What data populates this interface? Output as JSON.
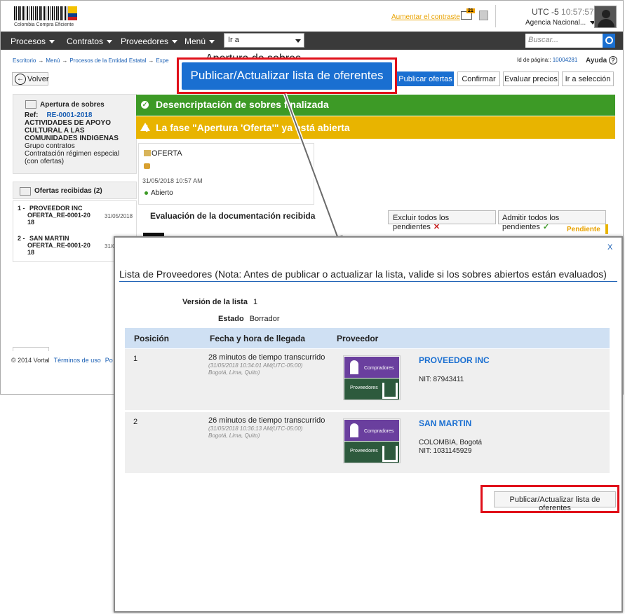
{
  "header": {
    "logo_text": "Colombia Compra Eficiente",
    "contrast_link": "Aumentar el contraste",
    "mail_count": "21",
    "utc_label": "UTC -5",
    "utc_time": "10:57:57",
    "agency": "Agencia Nacional..."
  },
  "nav": {
    "items": [
      "Procesos",
      "Contratos",
      "Proveedores",
      "Menú"
    ],
    "goto_value": "Ir a",
    "search_placeholder": "Buscar..."
  },
  "breadcrumb": {
    "items": [
      "Escritorio",
      "Menú",
      "Procesos de la Entidad Estatal",
      "Expe"
    ],
    "heading_fragment": "Apertura de sobres"
  },
  "page_info": {
    "id_label": "Id de página::",
    "id_value": "10004281",
    "help": "Ayuda"
  },
  "toolbar": {
    "back": "Volver",
    "callout_button": "Publicar/Actualizar lista de oferentes",
    "tabs": [
      "Publicar ofertas",
      "Confirmar",
      "Evaluar precios",
      "Ir a selección"
    ]
  },
  "process_panel": {
    "title": "Apertura de sobres",
    "ref_label": "Ref:",
    "ref_value": "RE-0001-2018",
    "object": "ACTIVIDADES DE APOYO CULTURAL A LAS COMUNIDADES INDIGENAS",
    "group": "Grupo contratos",
    "type": "Contratación régimen especial (con ofertas)"
  },
  "offers": {
    "header": "Ofertas recibidas (2)",
    "items": [
      {
        "index": "1 -",
        "supplier": "PROVEEDOR INC",
        "code_line1": "OFERTA_RE-0001-20",
        "code_line2": "18",
        "date": "31/05/2018"
      },
      {
        "index": "2 -",
        "supplier": "SAN MARTIN",
        "code_line1": "OFERTA_RE-0001-20",
        "code_line2": "18",
        "date": "31/0"
      }
    ]
  },
  "banners": {
    "green": "Desencriptación de sobres finalizada",
    "yellow": "La fase \"Apertura 'Oferta'\" ya está abierta"
  },
  "offer_box": {
    "label": "OFERTA",
    "date": "31/05/2018 10:57 AM",
    "status": "Abierto"
  },
  "evaluation": {
    "title": "Evaluación de la documentación recibida",
    "exclude_btn": "Excluir todos los pendientes",
    "admit_btn": "Admitir todos los pendientes",
    "pending": "Pendiente"
  },
  "footer": {
    "copyright": "© 2014 Vortal",
    "terms": "Términos de uso",
    "more": "Po"
  },
  "modal": {
    "close": "X",
    "title": "Lista de Proveedores (Nota: Antes de publicar o actualizar la lista, valide si los sobres abiertos están evaluados)",
    "version_label": "Versión de la lista",
    "version_value": "1",
    "state_label": "Estado",
    "state_value": "Borrador",
    "columns": [
      "Posición",
      "Fecha y hora de llegada",
      "Proveedor"
    ],
    "logo_top": "Compradores",
    "logo_bottom": "Proveedores",
    "rows": [
      {
        "position": "1",
        "elapsed": "28 minutos de tiempo transcurrido",
        "arrival": "(31/05/2018 10:34:01 AM(UTC-05:00)",
        "zone": "Bogotá, Lima, Quito)",
        "name": "PROVEEDOR INC",
        "location": "",
        "nit": "NIT: 87943411"
      },
      {
        "position": "2",
        "elapsed": "26 minutos de tiempo transcurrido",
        "arrival": "(31/05/2018 10:36:13 AM(UTC-05:00)",
        "zone": "Bogotá, Lima, Quito)",
        "name": "SAN MARTIN",
        "location": "COLOMBIA, Bogotá",
        "nit": "NIT: 1031145929"
      }
    ],
    "publish_button": "Publicar/Actualizar lista de oferentes"
  },
  "colors": {
    "primary": "#1a6fd1",
    "success": "#3d9a26",
    "warning": "#e8b400",
    "callout": "#e0101a",
    "navbar": "#3a3a3a"
  }
}
